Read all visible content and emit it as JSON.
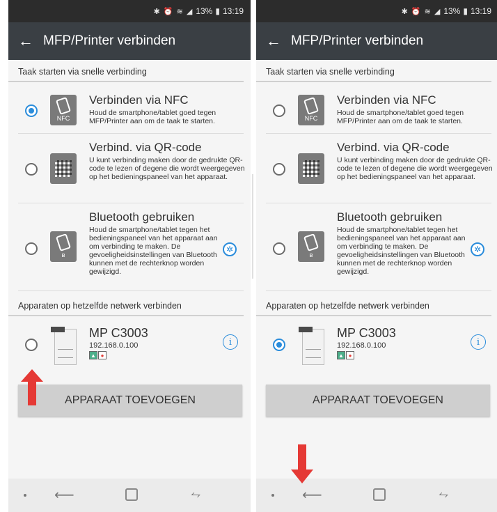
{
  "status": {
    "battery": "13%",
    "time": "13:19",
    "icons": "✱ ⏰ ≋ ◢"
  },
  "appbar": {
    "title": "MFP/Printer verbinden"
  },
  "section1": {
    "label": "Taak starten via snelle verbinding"
  },
  "options": [
    {
      "title": "Verbinden via NFC",
      "desc": "Houd de smartphone/tablet goed tegen MFP/Printer aan om de taak te starten.",
      "icon": "nfc-icon",
      "icon_label": "NFC"
    },
    {
      "title": "Verbind. via QR-code",
      "desc": "U kunt verbinding maken door de gedrukte QR-code te lezen of degene die wordt weergegeven op het bedieningspaneel van het apparaat.",
      "icon": "qr-code-icon"
    },
    {
      "title": "Bluetooth gebruiken",
      "desc": "Houd de smartphone/tablet tegen het bedieningspaneel van het apparaat aan om verbinding te maken. De gevoeligheidsinstellingen van Bluetooth kunnen met de rechterknop worden gewijzigd.",
      "icon": "bluetooth-icon"
    }
  ],
  "section2": {
    "label": "Apparaten op hetzelfde netwerk verbinden"
  },
  "device": {
    "name": "MP C3003",
    "ip": "192.168.0.100"
  },
  "add_button": {
    "label": "APPARAAT TOEVOEGEN"
  },
  "left_screen": {
    "selected": "nfc",
    "device_selected": false
  },
  "right_screen": {
    "selected": "device",
    "device_selected": true
  },
  "colors": {
    "accent": "#2a8cdb",
    "appbar": "#3a3f44",
    "annotation_arrow": "#e53935"
  }
}
